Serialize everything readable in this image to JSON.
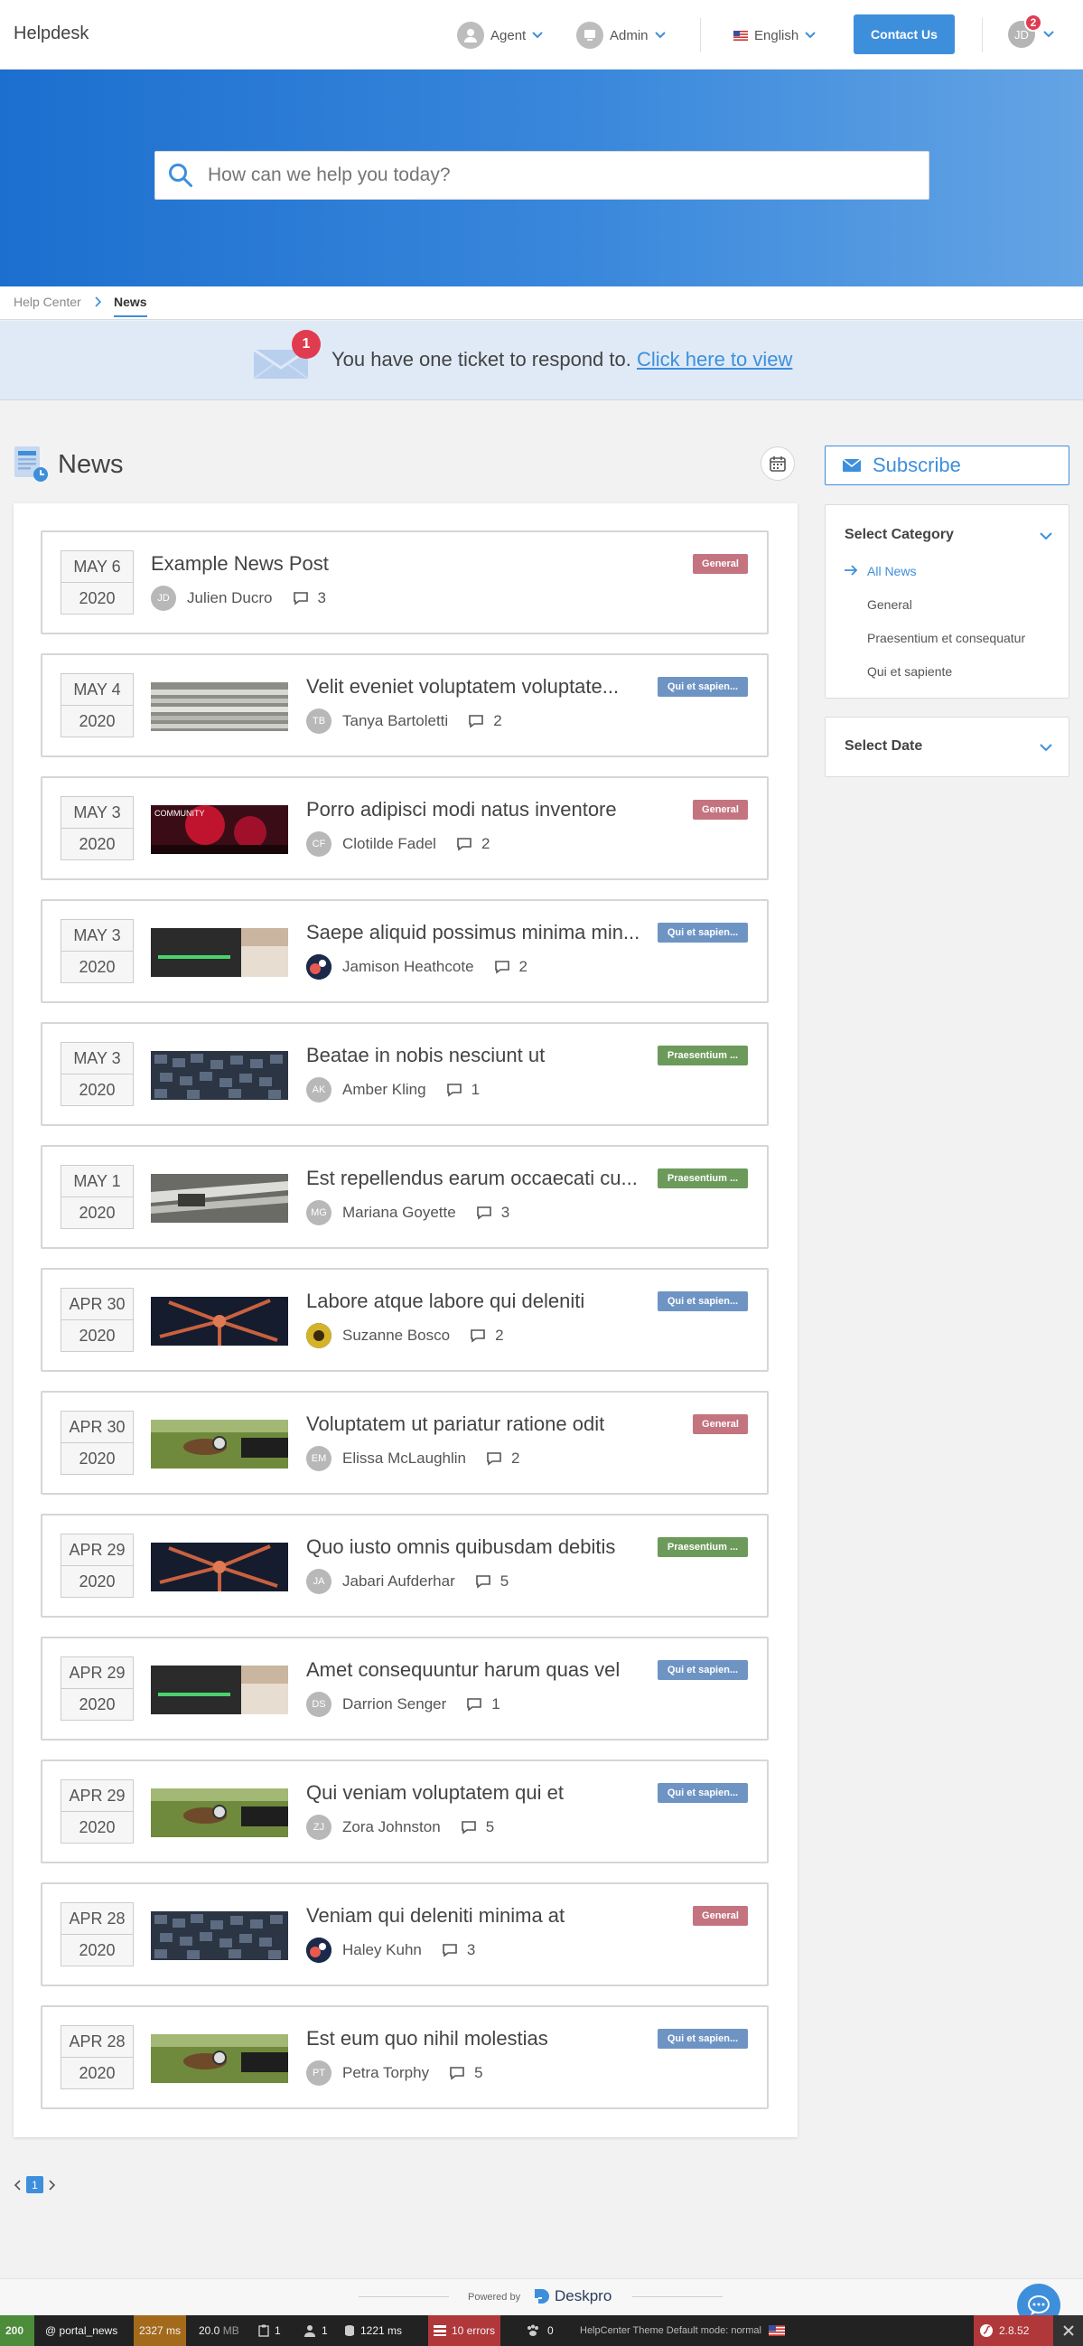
{
  "nav": {
    "brand": "Helpdesk",
    "agent": "Agent",
    "admin": "Admin",
    "language": "English",
    "contact": "Contact Us",
    "user_initials": "JD",
    "notif_count": "2"
  },
  "search": {
    "placeholder": "How can we help you today?"
  },
  "breadcrumb": {
    "home": "Help Center",
    "current": "News"
  },
  "banner": {
    "count": "1",
    "text": "You have one ticket to respond to.",
    "link": "Click here to view"
  },
  "page": {
    "title": "News"
  },
  "posts": [
    {
      "month_day": "MAY 6",
      "year": "2020",
      "title": "Example News Post",
      "author": "Julien Ducro",
      "initials": "JD",
      "comments": "3",
      "tag": "General"
    },
    {
      "month_day": "MAY 4",
      "year": "2020",
      "title": "Velit eveniet voluptatem voluptate...",
      "author": "Tanya Bartoletti",
      "initials": "TB",
      "comments": "2",
      "tag": "Qui et sapien..."
    },
    {
      "month_day": "MAY 3",
      "year": "2020",
      "title": "Porro adipisci modi natus inventore",
      "author": "Clotilde Fadel",
      "initials": "CF",
      "comments": "2",
      "tag": "General"
    },
    {
      "month_day": "MAY 3",
      "year": "2020",
      "title": "Saepe aliquid possimus minima min...",
      "author": "Jamison Heathcote",
      "initials": "",
      "comments": "2",
      "tag": "Qui et sapien..."
    },
    {
      "month_day": "MAY 3",
      "year": "2020",
      "title": "Beatae in nobis nesciunt ut",
      "author": "Amber Kling",
      "initials": "AK",
      "comments": "1",
      "tag": "Praesentium ..."
    },
    {
      "month_day": "MAY 1",
      "year": "2020",
      "title": "Est repellendus earum occaecati cu...",
      "author": "Mariana Goyette",
      "initials": "MG",
      "comments": "3",
      "tag": "Praesentium ..."
    },
    {
      "month_day": "APR 30",
      "year": "2020",
      "title": "Labore atque labore qui deleniti",
      "author": "Suzanne Bosco",
      "initials": "",
      "comments": "2",
      "tag": "Qui et sapien..."
    },
    {
      "month_day": "APR 30",
      "year": "2020",
      "title": "Voluptatem ut pariatur ratione odit",
      "author": "Elissa McLaughlin",
      "initials": "EM",
      "comments": "2",
      "tag": "General"
    },
    {
      "month_day": "APR 29",
      "year": "2020",
      "title": "Quo iusto omnis quibusdam debitis",
      "author": "Jabari Aufderhar",
      "initials": "JA",
      "comments": "5",
      "tag": "Praesentium ..."
    },
    {
      "month_day": "APR 29",
      "year": "2020",
      "title": "Amet consequuntur harum quas vel",
      "author": "Darrion Senger",
      "initials": "DS",
      "comments": "1",
      "tag": "Qui et sapien..."
    },
    {
      "month_day": "APR 29",
      "year": "2020",
      "title": "Qui veniam voluptatem qui et",
      "author": "Zora Johnston",
      "initials": "ZJ",
      "comments": "5",
      "tag": "Qui et sapien..."
    },
    {
      "month_day": "APR 28",
      "year": "2020",
      "title": "Veniam qui deleniti minima at",
      "author": "Haley Kuhn",
      "initials": "",
      "comments": "3",
      "tag": "General"
    },
    {
      "month_day": "APR 28",
      "year": "2020",
      "title": "Est eum quo nihil molestias",
      "author": "Petra Torphy",
      "initials": "PT",
      "comments": "5",
      "tag": "Qui et sapien..."
    }
  ],
  "pagination": {
    "current": "1"
  },
  "sidebar": {
    "subscribe": "Subscribe",
    "category_title": "Select Category",
    "categories": [
      "All News",
      "General",
      "Praesentium et consequatur",
      "Qui et sapiente"
    ],
    "date_title": "Select Date"
  },
  "footer": {
    "powered_by": "Powered by",
    "brand": "Deskpro"
  },
  "debug": {
    "status": "200",
    "route": "@ portal_news",
    "time": "2327 ms",
    "memory": "20.0",
    "memory_unit": "MB",
    "count1": "1",
    "count2": "1",
    "db_time": "1221 ms",
    "errors": "10 errors",
    "count3": "0",
    "theme": "HelpCenter Theme Default mode: normal",
    "version": "2.8.52"
  },
  "colors": {
    "accent": "#3d8fdc",
    "tag_general": "#c3747f",
    "tag_qui": "#6e94c4",
    "tag_prae": "#6c9a5a",
    "alert": "#e03b4f"
  }
}
